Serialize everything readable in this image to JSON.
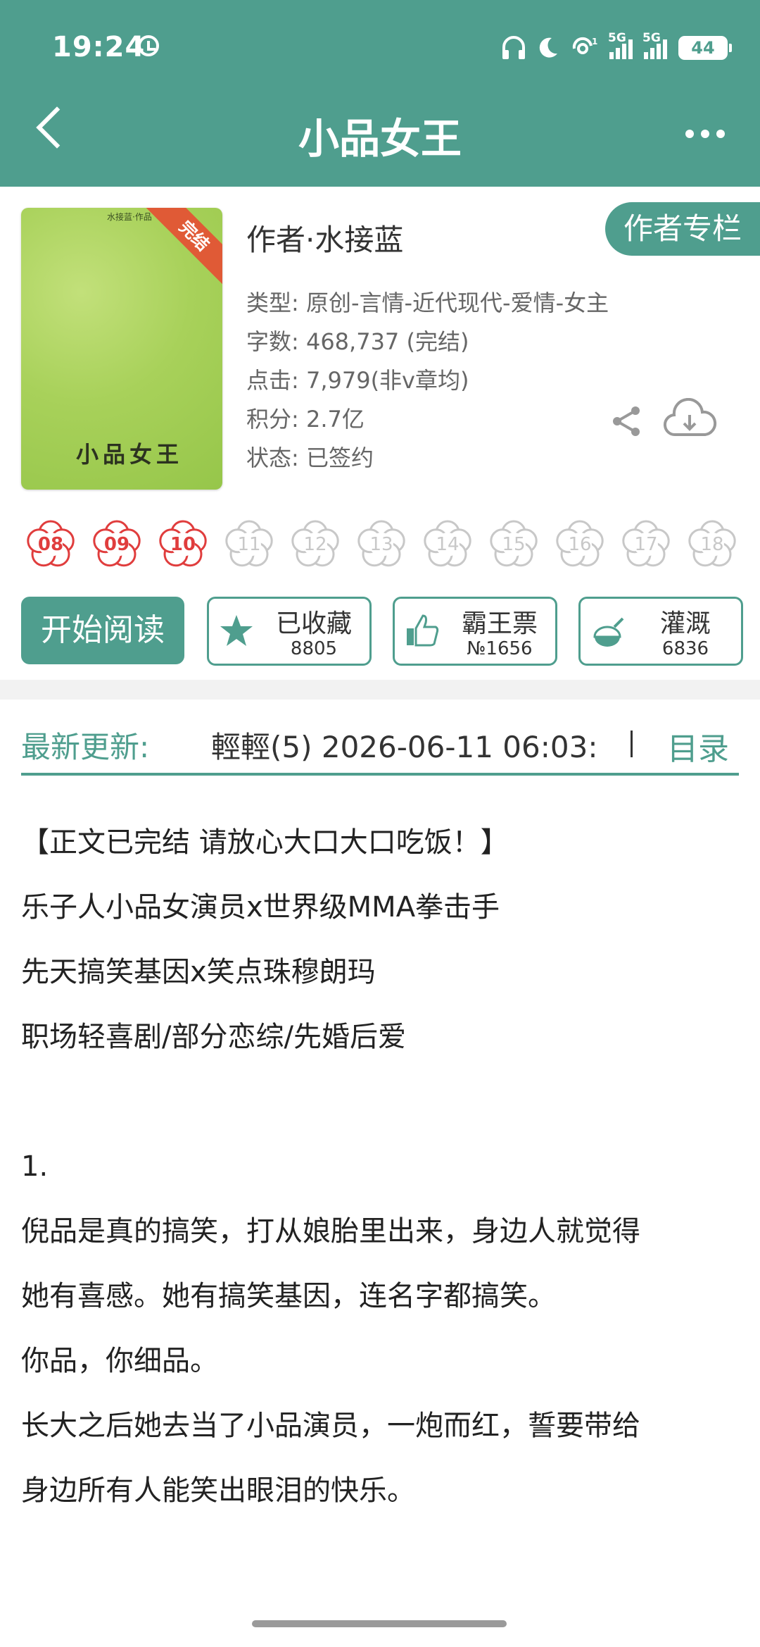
{
  "status_bar": {
    "time": "19:24",
    "signal_labels": [
      "5G",
      "5G"
    ],
    "battery": "44"
  },
  "nav": {
    "title": "小品女王"
  },
  "book": {
    "cover_title": "小品女王",
    "cover_small": "水接蓝·作品",
    "ribbon": "完结",
    "author": "作者·水接蓝",
    "author_column": "作者专栏",
    "meta": [
      "类型: 原创-言情-近代现代-爱情-女主",
      "字数: 468,737 (完结)",
      "点击: 7,979(非v章均)",
      "积分: 2.7亿",
      "状态: 已签约"
    ]
  },
  "flowers": [
    {
      "label": "08",
      "active": true
    },
    {
      "label": "09",
      "active": true
    },
    {
      "label": "10",
      "active": true
    },
    {
      "label": "11",
      "active": false
    },
    {
      "label": "12",
      "active": false
    },
    {
      "label": "13",
      "active": false
    },
    {
      "label": "14",
      "active": false
    },
    {
      "label": "15",
      "active": false
    },
    {
      "label": "16",
      "active": false
    },
    {
      "label": "17",
      "active": false
    },
    {
      "label": "18",
      "active": false
    }
  ],
  "actions": {
    "read": "开始阅读",
    "favorite": {
      "label": "已收藏",
      "count": "8805"
    },
    "ticket": {
      "label": "霸王票",
      "count": "№1656"
    },
    "irrigate": {
      "label": "灌溉",
      "count": "6836"
    }
  },
  "update": {
    "label": "最新更新:",
    "text": "輕輕(5)  2026-06-11 06:03:",
    "toc": "目录"
  },
  "intro": [
    "【正文已完结 请放心大口大口吃饭！】",
    "乐子人小品女演员x世界级MMA拳击手",
    "先天搞笑基因x笑点珠穆朗玛",
    "职场轻喜剧/部分恋综/先婚后爱",
    "",
    "1.",
    "倪品是真的搞笑，打从娘胎里出来，身边人就觉得",
    "她有喜感。她有搞笑基因，连名字都搞笑。",
    "你品，你细品。",
    "长大之后她去当了小品演员，一炮而红，誓要带给",
    "身边所有人能笑出眼泪的快乐。"
  ],
  "colors": {
    "primary": "#4f9e8e",
    "flower_active": "#e03d3d",
    "flower_inactive": "#c8c8c8"
  }
}
